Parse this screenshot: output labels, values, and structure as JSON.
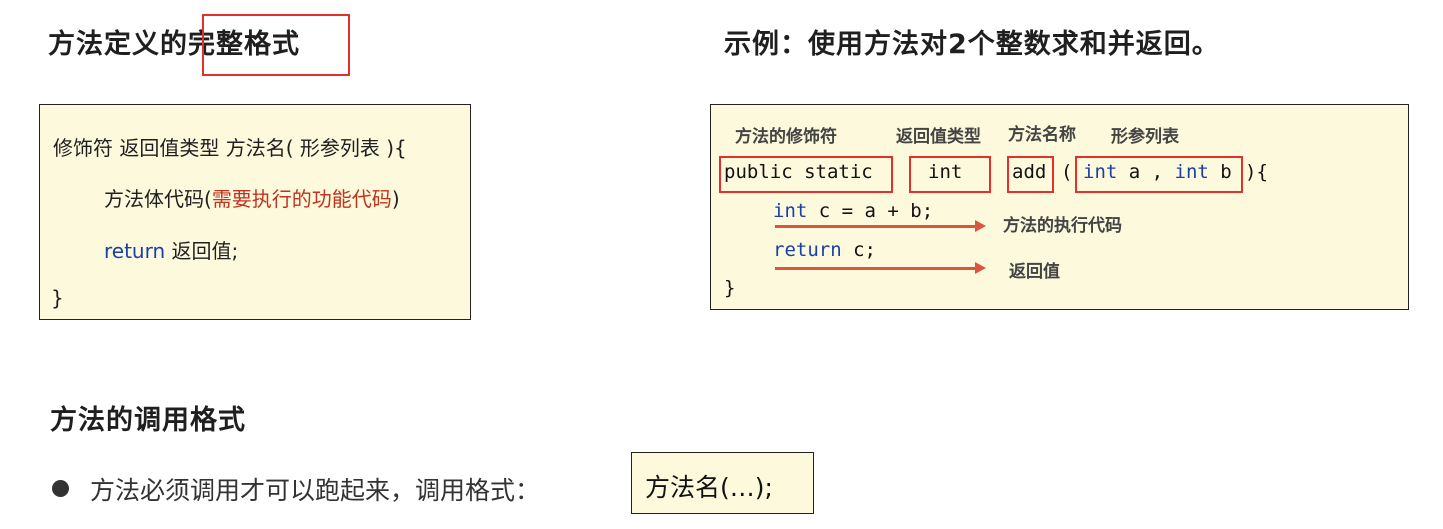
{
  "left": {
    "title_prefix": "方法定义的",
    "title_highlight": "完整格式",
    "code": {
      "signature": "修饰符  返回值类型  方法名( 形参列表 ){",
      "body_prefix": "方法体代码(",
      "body_highlight": "需要执行的功能代码",
      "body_suffix": ")",
      "return_keyword": "return",
      "return_rest": " 返回值;",
      "close": "}"
    }
  },
  "right": {
    "title": "示例：使用方法对2个整数求和并返回。",
    "labels": {
      "modifier": "方法的修饰符",
      "return_type": "返回值类型",
      "method_name": "方法名称",
      "params": "形参列表",
      "exec_code": "方法的执行代码",
      "return_value": "返回值"
    },
    "code": {
      "modifier": "public static",
      "return_type": "int",
      "method_name": "add",
      "open_paren": "(",
      "param1_type": "int",
      "param1_name": " a , ",
      "param2_type": "int",
      "param2_name": " b",
      "close_sig": "){",
      "line2_type": "int",
      "line2_rest": " c = a + b;",
      "line3_keyword": "return",
      "line3_rest": " c;",
      "close": "}"
    }
  },
  "bottom": {
    "title": "方法的调用格式",
    "bullet_text": "方法必须调用才可以跑起来，调用格式：",
    "call_format": "方法名(…);"
  },
  "colors": {
    "highlight_border": "#e0312b",
    "panel_background": "#fcf9dc",
    "keyword": "#1a3fa8",
    "arrow": "#d9563f"
  }
}
